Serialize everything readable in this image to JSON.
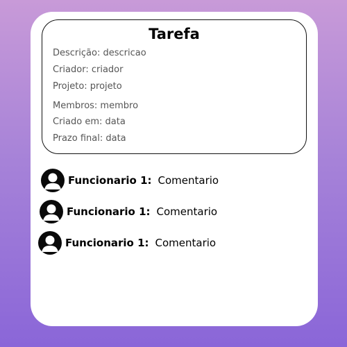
{
  "task": {
    "title": "Tarefa",
    "fields": [
      {
        "text": "Descrição: descricao"
      },
      {
        "text": "Criador: criador"
      },
      {
        "text": "Projeto: projeto"
      },
      {
        "text": "Membros: membro"
      },
      {
        "text": "Criado em: data"
      },
      {
        "text": "Prazo final: data"
      }
    ]
  },
  "comments": [
    {
      "author": "Funcionario 1:",
      "text": "Comentario",
      "avatar_icon": "user-avatar-icon"
    },
    {
      "author": "Funcionario 1:",
      "text": "Comentario",
      "avatar_icon": "user-avatar-icon"
    },
    {
      "author": "Funcionario 1:",
      "text": "Comentario",
      "avatar_icon": "user-avatar-icon"
    }
  ],
  "colors": {
    "background_top": "#c89ad8",
    "background_bottom": "#8a66d8",
    "card": "#ffffff",
    "avatar": "#0a0a0a"
  }
}
